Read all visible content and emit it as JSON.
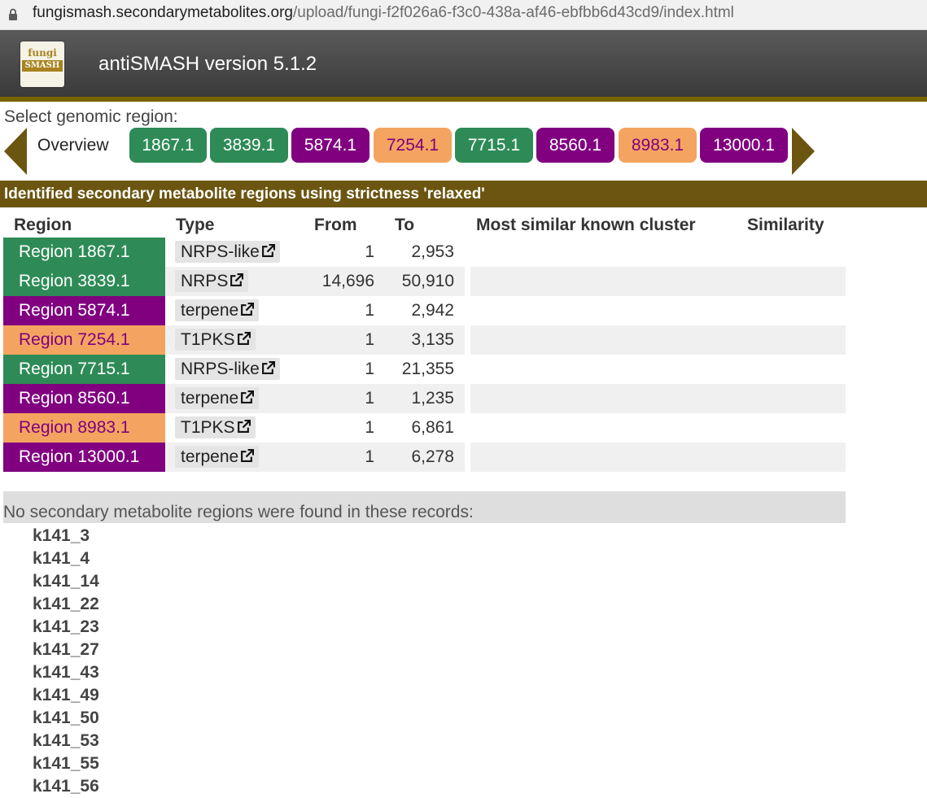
{
  "browser": {
    "url_host": "fungismash.secondarymetabolites.org",
    "url_path": "/upload/fungi-f2f026a6-f3c0-438a-af46-ebfbb6d43cd9/index.html"
  },
  "header": {
    "logo_top": "fungi",
    "logo_bottom": "SMASH",
    "title": "antiSMASH version 5.1.2"
  },
  "selector": {
    "label": "Select genomic region:",
    "overview": "Overview",
    "regions": [
      {
        "label": "1867.1",
        "color": "#2e8b57"
      },
      {
        "label": "3839.1",
        "color": "#2e8b57"
      },
      {
        "label": "5874.1",
        "color": "#800080"
      },
      {
        "label": "7254.1",
        "color": "#f4a460"
      },
      {
        "label": "7715.1",
        "color": "#2e8b57"
      },
      {
        "label": "8560.1",
        "color": "#800080"
      },
      {
        "label": "8983.1",
        "color": "#f4a460"
      },
      {
        "label": "13000.1",
        "color": "#800080"
      }
    ]
  },
  "banner": "Identified secondary metabolite regions using strictness 'relaxed'",
  "table": {
    "headers": [
      "Region",
      "Type",
      "From",
      "To",
      "Most similar known cluster",
      "Similarity"
    ],
    "rows": [
      {
        "region": "Region 1867.1",
        "type": "NRPS-like",
        "from": "1",
        "to": "2,953",
        "cluster": "",
        "similarity": ""
      },
      {
        "region": "Region 3839.1",
        "type": "NRPS",
        "from": "14,696",
        "to": "50,910",
        "cluster": "",
        "similarity": ""
      },
      {
        "region": "Region 5874.1",
        "type": "terpene",
        "from": "1",
        "to": "2,942",
        "cluster": "",
        "similarity": ""
      },
      {
        "region": "Region 7254.1",
        "type": "T1PKS",
        "from": "1",
        "to": "3,135",
        "cluster": "",
        "similarity": ""
      },
      {
        "region": "Region 7715.1",
        "type": "NRPS-like",
        "from": "1",
        "to": "21,355",
        "cluster": "",
        "similarity": ""
      },
      {
        "region": "Region 8560.1",
        "type": "terpene",
        "from": "1",
        "to": "1,235",
        "cluster": "",
        "similarity": ""
      },
      {
        "region": "Region 8983.1",
        "type": "T1PKS",
        "from": "1",
        "to": "6,861",
        "cluster": "",
        "similarity": ""
      },
      {
        "region": "Region 13000.1",
        "type": "terpene",
        "from": "1",
        "to": "6,278",
        "cluster": "",
        "similarity": ""
      }
    ]
  },
  "no_regions": {
    "message": "No secondary metabolite regions were found in these records:",
    "records": [
      "k141_3",
      "k141_4",
      "k141_14",
      "k141_22",
      "k141_23",
      "k141_27",
      "k141_43",
      "k141_49",
      "k141_50",
      "k141_53",
      "k141_55",
      "k141_56"
    ]
  },
  "colors": {
    "nrps": "#2e8b57",
    "terpene": "#800080",
    "t1pks": "#f4a460",
    "accent": "#6b5510"
  },
  "icons": {
    "lock": "lock-icon",
    "external": "external-link-icon",
    "prev": "triangle-left-icon",
    "next": "triangle-right-icon"
  }
}
